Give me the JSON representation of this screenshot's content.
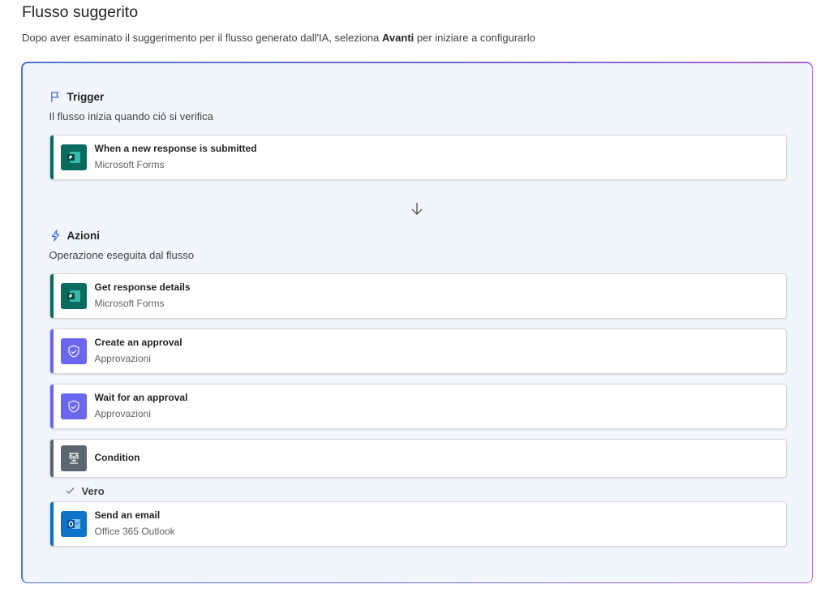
{
  "header": {
    "title": "Flusso suggerito",
    "subtitle_before": "Dopo aver esaminato il suggerimento per il flusso generato dall'IA, seleziona ",
    "subtitle_bold": "Avanti",
    "subtitle_after": " per iniziare a configurarlo"
  },
  "trigger_section": {
    "heading": "Trigger",
    "description": "Il flusso inizia quando ciò si verifica",
    "card": {
      "title": "When a new response is submitted",
      "subtitle": "Microsoft Forms",
      "icon": "microsoft-forms-icon"
    }
  },
  "actions_section": {
    "heading": "Azioni",
    "description": "Operazione eseguita dal flusso",
    "cards": [
      {
        "title": "Get response details",
        "subtitle": "Microsoft Forms",
        "icon": "microsoft-forms-icon"
      },
      {
        "title": "Create an approval",
        "subtitle": "Approvazioni",
        "icon": "approvals-icon"
      },
      {
        "title": "Wait for an approval",
        "subtitle": "Approvazioni",
        "icon": "approvals-icon"
      },
      {
        "title": "Condition",
        "subtitle": "",
        "icon": "condition-icon"
      }
    ],
    "branch": {
      "label": "Vero",
      "card": {
        "title": "Send an email",
        "subtitle": "Office 365 Outlook",
        "icon": "outlook-icon"
      }
    }
  },
  "colors": {
    "forms": "#0b6a5e",
    "approvals": "#6b66f0",
    "condition": "#5c6670",
    "outlook": "#0f72c9",
    "frame_start": "#4f76d9",
    "frame_end": "#a863d6",
    "frame_bg": "#f1f5fc"
  }
}
